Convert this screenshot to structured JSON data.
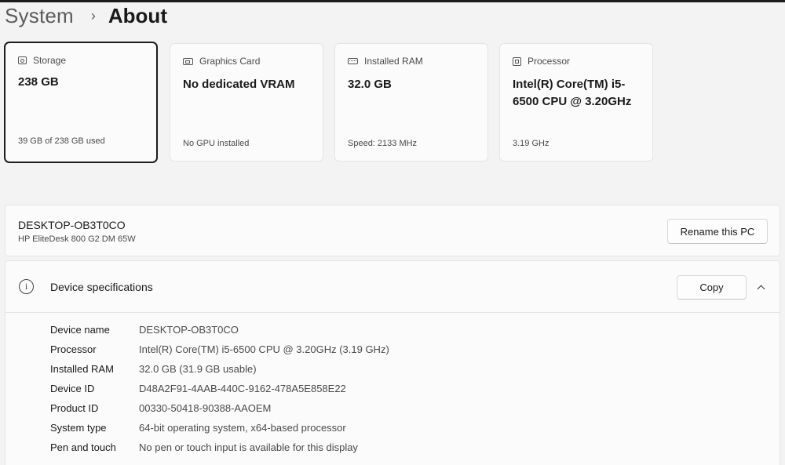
{
  "breadcrumb": {
    "parent": "System",
    "separator": "›",
    "current": "About"
  },
  "cards": [
    {
      "icon": "storage-icon",
      "title": "Storage",
      "value": "238 GB",
      "sub": "39 GB of 238 GB used"
    },
    {
      "icon": "graphics-card-icon",
      "title": "Graphics Card",
      "value": "No dedicated VRAM",
      "sub": "No GPU installed"
    },
    {
      "icon": "ram-icon",
      "title": "Installed RAM",
      "value": "32.0 GB",
      "sub": "Speed: 2133 MHz"
    },
    {
      "icon": "processor-icon",
      "title": "Processor",
      "value": "Intel(R) Core(TM) i5-6500 CPU @ 3.20GHz",
      "sub": "3.19 GHz"
    }
  ],
  "pc": {
    "name": "DESKTOP-OB3T0CO",
    "model": "HP EliteDesk 800 G2 DM 65W",
    "rename_label": "Rename this PC"
  },
  "specs": {
    "info_glyph": "i",
    "title": "Device specifications",
    "copy_label": "Copy",
    "rows": [
      {
        "label": "Device name",
        "value": "DESKTOP-OB3T0CO"
      },
      {
        "label": "Processor",
        "value": "Intel(R) Core(TM) i5-6500 CPU @ 3.20GHz (3.19 GHz)"
      },
      {
        "label": "Installed RAM",
        "value": "32.0 GB (31.9 GB usable)"
      },
      {
        "label": "Device ID",
        "value": "D48A2F91-4AAB-440C-9162-478A5E858E22"
      },
      {
        "label": "Product ID",
        "value": "00330-50418-90388-AAOEM"
      },
      {
        "label": "System type",
        "value": "64-bit operating system, x64-based processor"
      },
      {
        "label": "Pen and touch",
        "value": "No pen or touch input is available for this display"
      }
    ]
  }
}
